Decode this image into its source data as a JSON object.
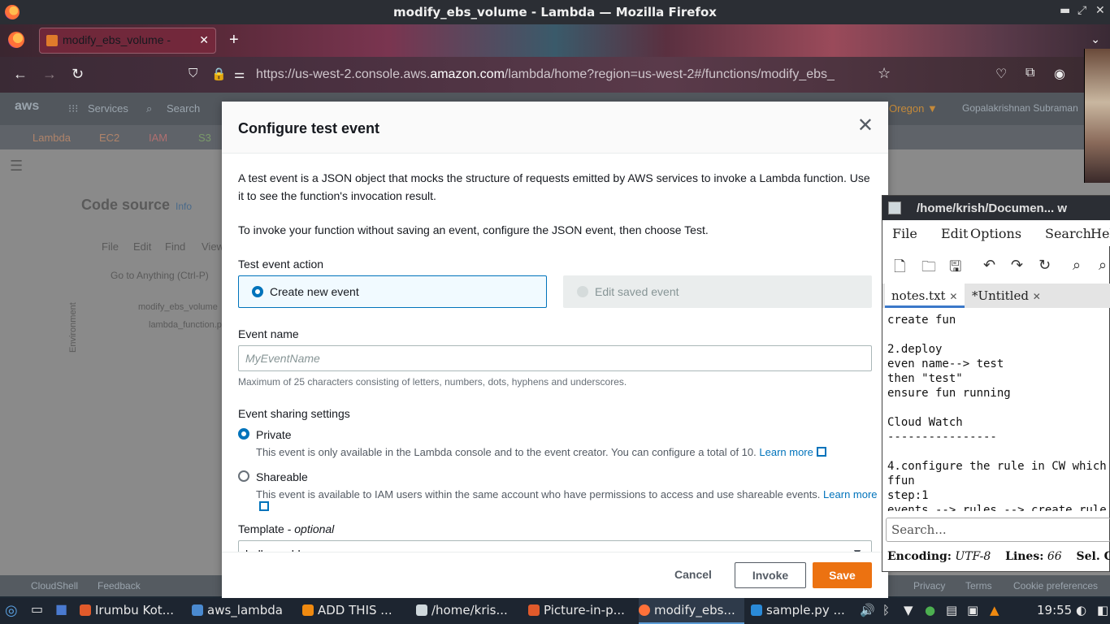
{
  "window": {
    "title": "modify_ebs_volume - Lambda — Mozilla Firefox"
  },
  "browser": {
    "tab_label": "modify_ebs_volume - ",
    "url_prefix": "https://us-west-2.console.aws.",
    "url_domain": "amazon.com",
    "url_suffix": "/lambda/home?region=us-west-2#/functions/modify_ebs_"
  },
  "aws_bg": {
    "services": "Services",
    "search": "Search",
    "region": "Oregon ▼",
    "user": "Gopalakrishnan Subraman",
    "fav_lambda": "Lambda",
    "fav_ec2": "EC2",
    "fav_iam": "IAM",
    "fav_s3": "S3",
    "code_source": "Code source",
    "info": "Info",
    "menu_file": "File",
    "menu_edit": "Edit",
    "menu_find": "Find",
    "menu_view": "View",
    "goto": "Go to Anything (Ctrl-P)",
    "folder": "modify_ebs_volume",
    "file": "lambda_function.p",
    "environment": "Environment",
    "cloudshell": "CloudShell",
    "feedback": "Feedback",
    "privacy": "Privacy",
    "terms": "Terms",
    "cookie": "Cookie preferences"
  },
  "modal": {
    "title": "Configure test event",
    "intro1": "A test event is a JSON object that mocks the structure of requests emitted by AWS services to invoke a Lambda function. Use it to see the function's invocation result.",
    "intro2": "To invoke your function without saving an event, configure the JSON event, then choose Test.",
    "action_label": "Test event action",
    "option_create": "Create new event",
    "option_edit": "Edit saved event",
    "name_label": "Event name",
    "name_placeholder": "MyEventName",
    "name_hint": "Maximum of 25 characters consisting of letters, numbers, dots, hyphens and underscores.",
    "sharing_label": "Event sharing settings",
    "private_label": "Private",
    "private_desc": "This event is only available in the Lambda console and to the event creator. You can configure a total of 10.",
    "learn_more": "Learn more",
    "shareable_label": "Shareable",
    "shareable_desc": "This event is available to IAM users within the same account who have permissions to access and use shareable events.",
    "template_label": "Template - ",
    "template_optional": "optional",
    "template_value": "hello-world",
    "cancel": "Cancel",
    "invoke": "Invoke",
    "save": "Save"
  },
  "editor": {
    "title": "/home/krish/Documen... w",
    "menu": [
      "File",
      "Edit",
      "Options",
      "Search",
      "Help"
    ],
    "tab1": "notes.txt",
    "tab2": "*Untitled",
    "text": "create fun\n\n2.deploy\neven name--> test\nthen \"test\"\nensure fun running\n\nCloud Watch\n----------------\n\n4.configure the rule in CW which\nffun\nstep:1\nevents --> rules --> create rule",
    "search_placeholder": "Search...",
    "encoding_label": "Encoding:",
    "encoding_value": "UTF-8",
    "lines_label": "Lines:",
    "lines_value": "66",
    "sel_label": "Sel. C"
  },
  "taskbar": {
    "items": [
      "Irumbu Kot...",
      "aws_lambda",
      "ADD THIS ...",
      "/home/kris...",
      "Picture-in-p...",
      "modify_ebs...",
      "sample.py ..."
    ],
    "clock": "19:55"
  }
}
